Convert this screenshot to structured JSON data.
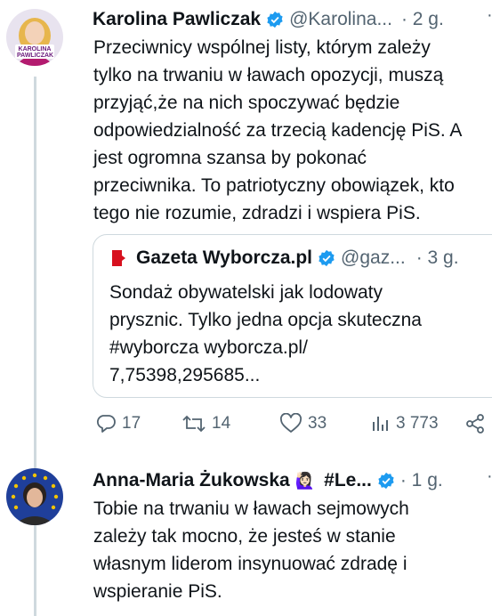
{
  "tweet1": {
    "name": "Karolina Pawliczak",
    "handle": "@Karolina...",
    "time": "· 2 g.",
    "avatar_text": "KAROLINA PAWLICZAK",
    "lines": [
      "Przeciwnicy wspólnej listy, którym zależy",
      "tylko na trwaniu w ławach opozycji, muszą",
      "przyjąć,że na nich spoczywać będzie",
      "odpowiedzialność za trzecią kadencję PiS. A",
      "jest ogromna szansa by pokonać",
      "przeciwnika. To patriotyczny obowiązek, kto",
      "tego nie rozumie, zdradzi i wspiera  PiS."
    ],
    "quote": {
      "name": "Gazeta Wyborcza.pl",
      "handle": "@gaz...",
      "time": "· 3 g.",
      "lines": [
        "Sondaż obywatelski jak lodowaty",
        "prysznic. Tylko jedna opcja skuteczna",
        "#wyborcza wyborcza.pl/",
        "7,75398,295685..."
      ]
    },
    "actions": {
      "replies": "17",
      "retweets": "14",
      "likes": "33",
      "views": "3 773"
    }
  },
  "tweet2": {
    "name": "Anna-Maria Żukowska",
    "name_suffix": "#Le...",
    "handle": "",
    "time": "· 1 g.",
    "lines": [
      "Tobie na trwaniu w ławach sejmowych",
      "zależy tak mocno, że jesteś w stanie",
      "własnym liderom insynuować zdradę i",
      "wspieranie PiS."
    ]
  },
  "colors": {
    "text": "#0f1419",
    "secondary": "#536471",
    "verified": "#1d9bf0",
    "border": "#cfd9de",
    "eu_blue": "#1f3f9a",
    "eu_star": "#f3c400"
  }
}
